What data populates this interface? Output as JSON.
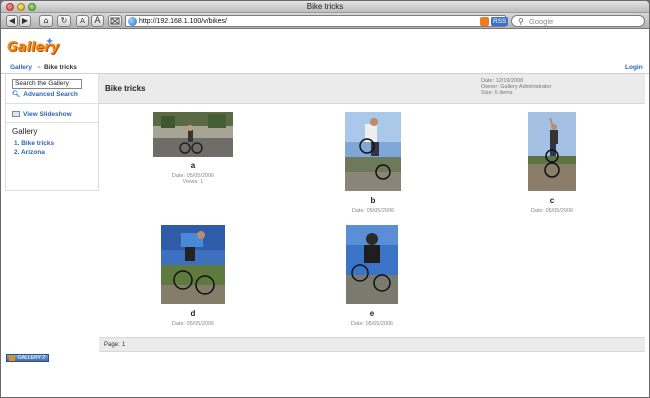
{
  "window": {
    "title": "Bike tricks"
  },
  "toolbar": {
    "url": "http://192.168.1.100/v/bikes/",
    "rss_label": "RSS",
    "search_placeholder": "Google",
    "back_glyph": "◀",
    "forward_glyph": "▶",
    "home_glyph": "⌂",
    "reload_glyph": "↻",
    "text_smaller": "A",
    "text_larger": "A"
  },
  "site": {
    "logo_text": "Gallery",
    "login_label": "Login",
    "breadcrumb": [
      {
        "label": "Gallery"
      },
      {
        "label": "Bike tricks"
      }
    ],
    "breadcrumb_sep": "»"
  },
  "sidebar": {
    "search_value": "Search the Gallery",
    "advanced_search": "Advanced Search",
    "view_slideshow": "View Slideshow",
    "heading": "Gallery",
    "albums": [
      "1. Bike tricks",
      "2. Arizona"
    ]
  },
  "album": {
    "title": "Bike tricks",
    "meta": {
      "date": "Date: 12/19/2008",
      "owner": "Owner: Gallery Administrator",
      "size": "Size: 5 items"
    },
    "items": [
      {
        "title": "a",
        "date": "Date: 05/05/2006",
        "views": "Views: 1"
      },
      {
        "title": "b",
        "date": "Date: 05/05/2006"
      },
      {
        "title": "c",
        "date": "Date: 05/05/2006"
      },
      {
        "title": "d",
        "date": "Date: 05/05/2006"
      },
      {
        "title": "e",
        "date": "Date: 05/05/2006"
      }
    ]
  },
  "pager": {
    "label": "Page:",
    "current": "1"
  },
  "footer": {
    "badge_text": "GALLERY 2"
  },
  "colors": {
    "link": "#2f66b0",
    "header_bg": "#ebebeb",
    "logo": "#f08a1a"
  }
}
